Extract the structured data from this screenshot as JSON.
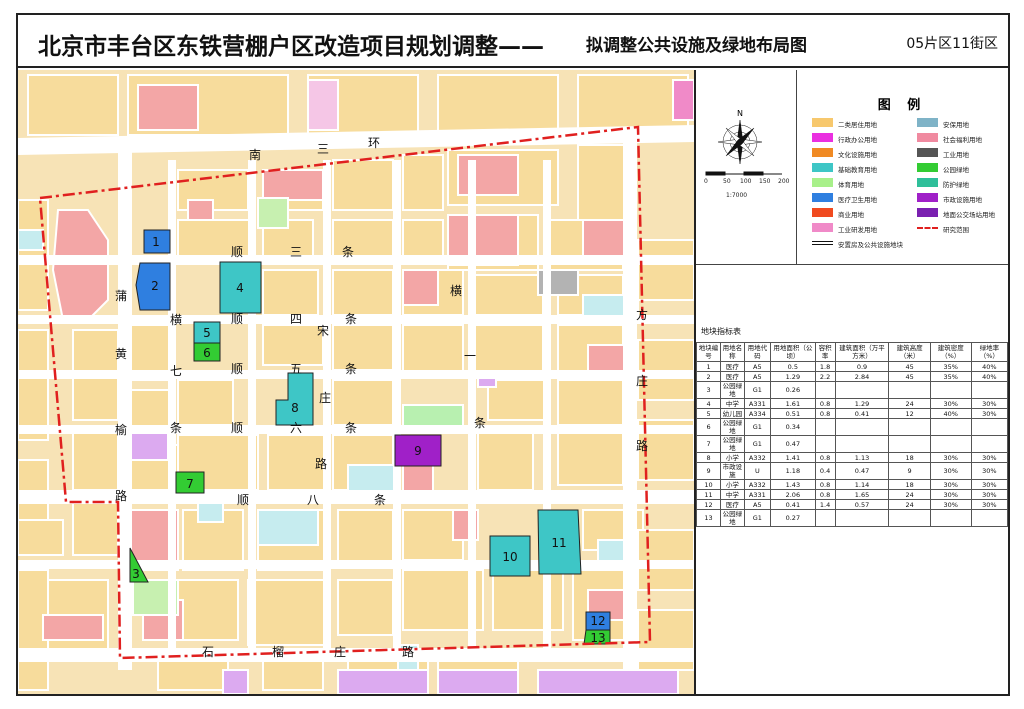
{
  "title": {
    "main": "北京市丰台区东铁营棚户区改造项目规划调整——",
    "sub": "拟调整公共设施及绿地布局图",
    "zone": "05片区11街区"
  },
  "compass": {
    "north": "N",
    "scale_ticks": [
      "0",
      "50",
      "100",
      "150",
      "200"
    ],
    "scale_ratio": "1:7000"
  },
  "legend": {
    "title": "图 例",
    "items": [
      {
        "label": "二类居住用地",
        "color": "#f7c86d"
      },
      {
        "label": "安保用地",
        "color": "#7fb3c7"
      },
      {
        "label": "行政办公用地",
        "color": "#ea2fe0"
      },
      {
        "label": "社会福利用地",
        "color": "#f08aa0"
      },
      {
        "label": "文化设施用地",
        "color": "#f08a24"
      },
      {
        "label": "工业用地",
        "color": "#555555"
      },
      {
        "label": "基础教育用地",
        "color": "#3ec6c6"
      },
      {
        "label": "公园绿地",
        "color": "#33cc33"
      },
      {
        "label": "体育用地",
        "color": "#a8f08a"
      },
      {
        "label": "防护绿地",
        "color": "#2fbf9a"
      },
      {
        "label": "医疗卫生用地",
        "color": "#2f7fe0"
      },
      {
        "label": "市政设施用地",
        "color": "#a020c8"
      },
      {
        "label": "商业用地",
        "color": "#f04a1f"
      },
      {
        "label": "地面公交场站用地",
        "color": "#7a20b0"
      },
      {
        "label": "工业研发用地",
        "color": "#f08ac8"
      },
      {
        "label": "研究范围",
        "color": "#e0201f"
      },
      {
        "label": "安置房及公共设施地块",
        "color": "#111111"
      }
    ]
  },
  "table": {
    "title": "地块指标表",
    "headers": [
      "地块编号",
      "用地名称",
      "用地代码",
      "用地面积（公顷）",
      "容积率",
      "建筑面积（万平方米）",
      "建筑高度（米）",
      "建筑密度（%）",
      "绿地率（%）"
    ],
    "rows": [
      [
        "1",
        "医疗",
        "A5",
        "0.5",
        "1.8",
        "0.9",
        "45",
        "35%",
        "40%"
      ],
      [
        "2",
        "医疗",
        "A5",
        "1.29",
        "2.2",
        "2.84",
        "45",
        "35%",
        "40%"
      ],
      [
        "3",
        "公园绿地",
        "G1",
        "0.26",
        "",
        "",
        "",
        "",
        ""
      ],
      [
        "4",
        "中学",
        "A331",
        "1.61",
        "0.8",
        "1.29",
        "24",
        "30%",
        "30%"
      ],
      [
        "5",
        "幼儿园",
        "A334",
        "0.51",
        "0.8",
        "0.41",
        "12",
        "40%",
        "30%"
      ],
      [
        "6",
        "公园绿地",
        "G1",
        "0.34",
        "",
        "",
        "",
        "",
        ""
      ],
      [
        "7",
        "公园绿地",
        "G1",
        "0.47",
        "",
        "",
        "",
        "",
        ""
      ],
      [
        "8",
        "小学",
        "A332",
        "1.41",
        "0.8",
        "1.13",
        "18",
        "30%",
        "30%"
      ],
      [
        "9",
        "市政设施",
        "U",
        "1.18",
        "0.4",
        "0.47",
        "9",
        "30%",
        "30%"
      ],
      [
        "10",
        "小学",
        "A332",
        "1.43",
        "0.8",
        "1.14",
        "18",
        "30%",
        "30%"
      ],
      [
        "11",
        "中学",
        "A331",
        "2.06",
        "0.8",
        "1.65",
        "24",
        "30%",
        "30%"
      ],
      [
        "12",
        "医疗",
        "A5",
        "0.41",
        "1.4",
        "0.57",
        "24",
        "30%",
        "30%"
      ],
      [
        "13",
        "公园绿地",
        "G1",
        "0.27",
        "",
        "",
        "",
        "",
        ""
      ]
    ]
  },
  "map": {
    "road_labels": [
      {
        "text": "南"
      },
      {
        "text": "三"
      },
      {
        "text": "环"
      },
      {
        "text": "顺"
      },
      {
        "text": "三"
      },
      {
        "text": "条"
      },
      {
        "text": "蒲"
      },
      {
        "text": "黄"
      },
      {
        "text": "榆"
      },
      {
        "text": "路"
      },
      {
        "text": "横"
      },
      {
        "text": "七"
      },
      {
        "text": "条"
      },
      {
        "text": "顺"
      },
      {
        "text": "四"
      },
      {
        "text": "条"
      },
      {
        "text": "宋"
      },
      {
        "text": "顺"
      },
      {
        "text": "五"
      },
      {
        "text": "条"
      },
      {
        "text": "庄"
      },
      {
        "text": "顺"
      },
      {
        "text": "六"
      },
      {
        "text": "条"
      },
      {
        "text": "路"
      },
      {
        "text": "顺"
      },
      {
        "text": "八"
      },
      {
        "text": "条"
      },
      {
        "text": "横"
      },
      {
        "text": "一"
      },
      {
        "text": "条"
      },
      {
        "text": "方"
      },
      {
        "text": "庄"
      },
      {
        "text": "路"
      },
      {
        "text": "石"
      },
      {
        "text": "榴"
      },
      {
        "text": "庄"
      },
      {
        "text": "路"
      }
    ],
    "parcels": [
      {
        "id": "1",
        "color": "#2f7fe0"
      },
      {
        "id": "2",
        "color": "#2f7fe0"
      },
      {
        "id": "3",
        "color": "#33cc33"
      },
      {
        "id": "4",
        "color": "#3ec6c6"
      },
      {
        "id": "5",
        "color": "#3ec6c6"
      },
      {
        "id": "6",
        "color": "#33cc33"
      },
      {
        "id": "7",
        "color": "#33cc33"
      },
      {
        "id": "8",
        "color": "#3ec6c6"
      },
      {
        "id": "9",
        "color": "#a020c8"
      },
      {
        "id": "10",
        "color": "#3ec6c6"
      },
      {
        "id": "11",
        "color": "#3ec6c6"
      },
      {
        "id": "12",
        "color": "#2f7fe0"
      },
      {
        "id": "13",
        "color": "#33cc33"
      }
    ]
  }
}
